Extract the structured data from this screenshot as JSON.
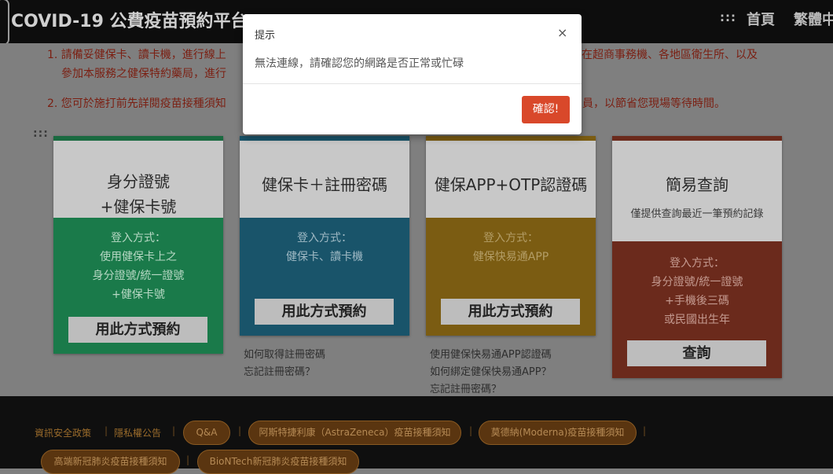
{
  "header": {
    "title": "COVID-19 公費疫苗預約平台",
    "menu_icon": ":::",
    "home": "首頁",
    "language": "繁體中文"
  },
  "notices": [
    {
      "line1a": "1. 請備妥健保卡、讀卡機，進行線上",
      "line1b": "在超商事務機、各地區衛生所、以及",
      "line2": "參加本服務之健保特約藥局，進行"
    },
    {
      "line1a": "2. 您可於施打前先詳閱疫苗接種須知",
      "line1b": "員，以節省您現場等待時間。"
    }
  ],
  "drag_handle": ":::",
  "cards": [
    {
      "title_lines": [
        "身分證號",
        "+健保卡號"
      ],
      "login_lines": [
        "登入方式：",
        "使用健保卡上之",
        "身分證號/統一證號",
        "+健保卡號"
      ],
      "button": "用此方式預約",
      "links": [],
      "accent": "#1a7a4a"
    },
    {
      "title_lines": [
        "健保卡＋註冊密碼"
      ],
      "login_lines": [
        "登入方式：",
        "健保卡、讀卡機"
      ],
      "button": "用此方式預約",
      "links": [
        "如何取得註冊密碼",
        "忘記註冊密碼？"
      ],
      "accent": "#19546a"
    },
    {
      "title_lines": [
        "健保APP+OTP認證碼"
      ],
      "login_lines": [
        "登入方式：",
        "健保快易通APP"
      ],
      "button": "用此方式預約",
      "links": [
        "使用健保快易通APP認證碼",
        "如何綁定健保快易通APP？",
        "忘記註冊密碼？"
      ],
      "accent": "#7b5c12"
    },
    {
      "title_lines": [
        "簡易查詢"
      ],
      "subtitle": "僅提供查詢最近一筆預約記錄",
      "login_lines": [
        "登入方式：",
        "身分證號/統一證號",
        "+手機後三碼",
        "或民國出生年"
      ],
      "button": "查詢",
      "links": [],
      "accent": "#6b2a1c"
    }
  ],
  "footer": {
    "security_policy": "資訊安全政策",
    "privacy": "隱私權公告",
    "separator": "|",
    "pills": [
      "Q&A",
      "阿斯特捷利康（AstraZeneca）疫苗接種須知",
      "莫德納(Moderna)疫苗接種須知",
      "高端新冠肺炎疫苗接種須知",
      "BioNTech新冠肺炎疫苗接種須知"
    ]
  },
  "modal": {
    "title": "提示",
    "close": "×",
    "message": "無法連線，請確認您的網路是否正常或忙碌",
    "confirm": "確認!"
  },
  "colors": {
    "overlay": "#7f7f7f",
    "notice_text": "#7b1f12",
    "confirm_button": "#d9482a",
    "pill_border": "#8a5a22"
  }
}
